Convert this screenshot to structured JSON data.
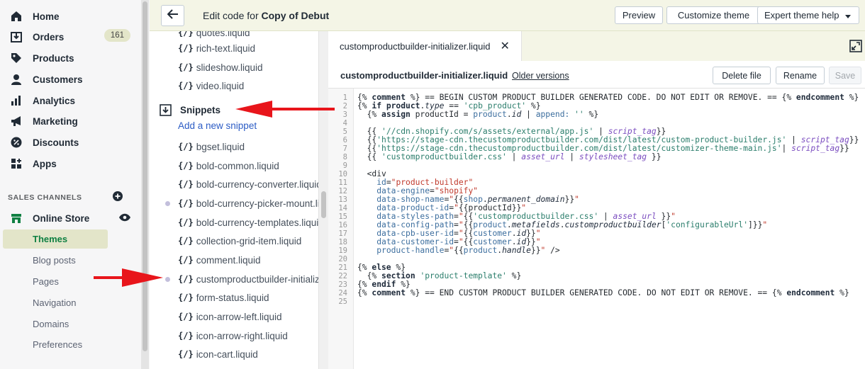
{
  "admin_nav": {
    "items": [
      {
        "label": "Home",
        "icon": "home-icon"
      },
      {
        "label": "Orders",
        "icon": "orders-icon",
        "badge": "161"
      },
      {
        "label": "Products",
        "icon": "tag-icon"
      },
      {
        "label": "Customers",
        "icon": "person-icon"
      },
      {
        "label": "Analytics",
        "icon": "bar-chart-icon"
      },
      {
        "label": "Marketing",
        "icon": "megaphone-icon"
      },
      {
        "label": "Discounts",
        "icon": "discount-icon"
      },
      {
        "label": "Apps",
        "icon": "apps-icon"
      }
    ],
    "sales_channels_label": "SALES CHANNELS",
    "online_store_label": "Online Store",
    "sub_items": [
      "Themes",
      "Blog posts",
      "Pages",
      "Navigation",
      "Domains",
      "Preferences"
    ]
  },
  "header": {
    "title_prefix": "Edit code for",
    "theme_name": "Copy of Debut",
    "preview_label": "Preview",
    "customize_label": "Customize theme",
    "expert_help_label": "Expert theme help"
  },
  "file_list": {
    "above": [
      "quotes.liquid",
      "rich-text.liquid",
      "slideshow.liquid",
      "video.liquid"
    ],
    "snippets_heading": "Snippets",
    "add_snippet": "Add a new snippet",
    "snippets": [
      "bgset.liquid",
      "bold-common.liquid",
      "bold-currency-converter.liquid",
      "bold-currency-picker-mount.liquid",
      "bold-currency-templates.liquid",
      "collection-grid-item.liquid",
      "comment.liquid",
      "customproductbuilder-initializer.liquid",
      "form-status.liquid",
      "icon-arrow-left.liquid",
      "icon-arrow-right.liquid",
      "icon-cart.liquid"
    ],
    "icon_glyph": "{/}"
  },
  "editor": {
    "tab_label": "customproductbuilder-initializer.liquid",
    "file_name": "customproductbuilder-initializer.liquid",
    "older_versions": "Older versions",
    "delete_label": "Delete file",
    "rename_label": "Rename",
    "save_label": "Save",
    "line_numbers": [
      "1",
      "2",
      "3",
      "4",
      "5",
      "6",
      "7",
      "8",
      "9",
      "10",
      "11",
      "12",
      "13",
      "14",
      "15",
      "16",
      "17",
      "18",
      "19",
      "20",
      "21",
      "22",
      "23",
      "24",
      "25"
    ]
  },
  "colors": {
    "accent_green": "#108043",
    "active_bg": "#e3e5c9",
    "link_blue": "#2c5cc5",
    "arrow_red": "#e8151b"
  }
}
